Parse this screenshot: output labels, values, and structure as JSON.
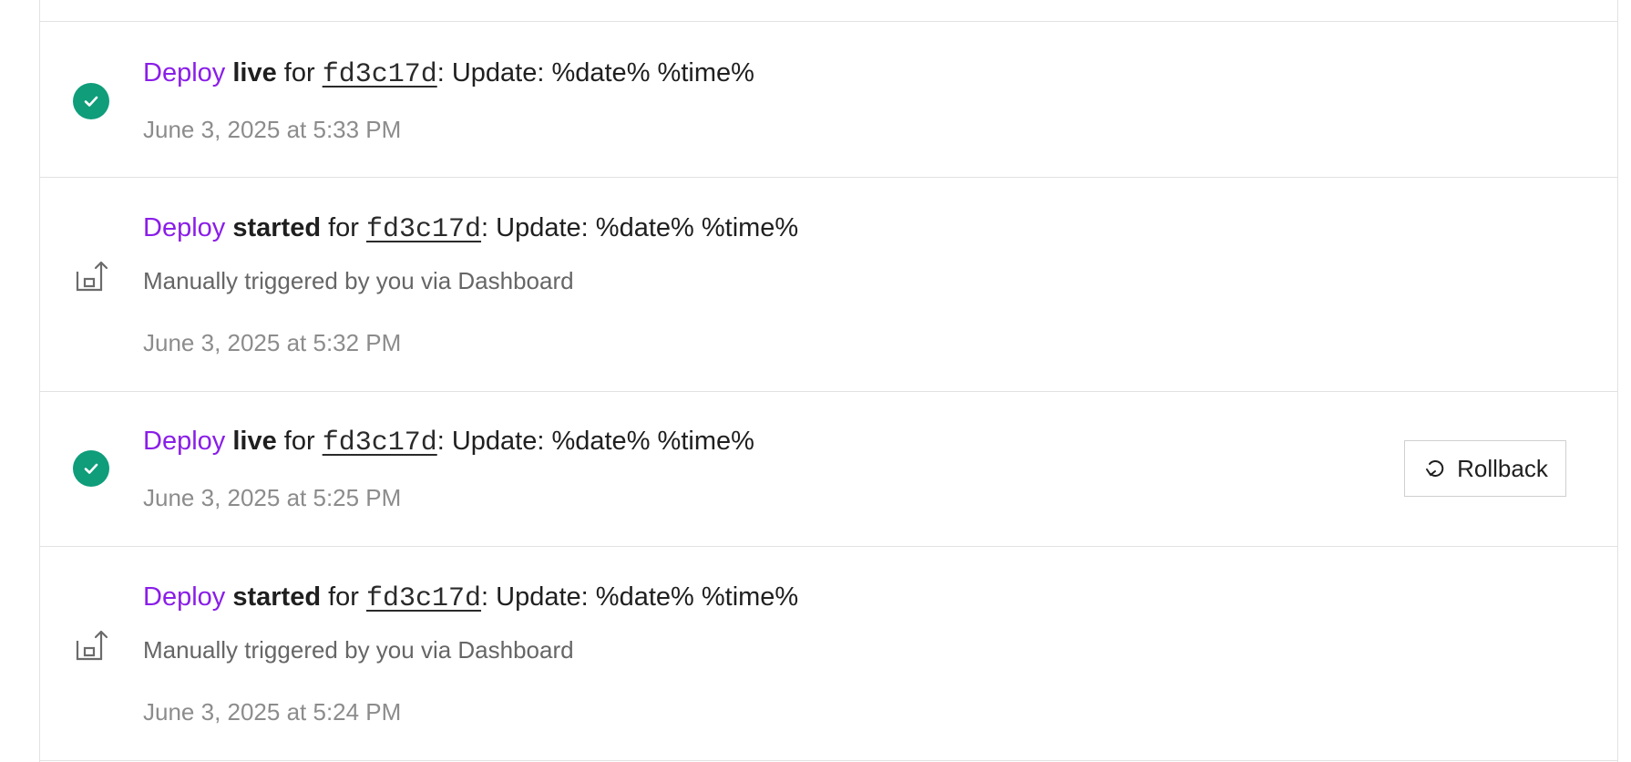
{
  "events": [
    {
      "deploy_label": "Deploy",
      "status": "live",
      "for_word": "for",
      "commit": "fd3c17d",
      "message": ": Update: %date% %time%",
      "trigger": "",
      "timestamp": "June 3, 2025 at 5:33 PM",
      "icon": "check-circle-icon"
    },
    {
      "deploy_label": "Deploy",
      "status": "started",
      "for_word": "for",
      "commit": "fd3c17d",
      "message": ": Update: %date% %time%",
      "trigger": "Manually triggered by you via Dashboard",
      "timestamp": "June 3, 2025 at 5:32 PM",
      "icon": "deploy-upload-icon"
    },
    {
      "deploy_label": "Deploy",
      "status": "live",
      "for_word": "for",
      "commit": "fd3c17d",
      "message": ": Update: %date% %time%",
      "trigger": "",
      "timestamp": "June 3, 2025 at 5:25 PM",
      "icon": "check-circle-icon",
      "action_label": "Rollback",
      "action_icon": "rollback-icon"
    },
    {
      "deploy_label": "Deploy",
      "status": "started",
      "for_word": "for",
      "commit": "fd3c17d",
      "message": ": Update: %date% %time%",
      "trigger": "Manually triggered by you via Dashboard",
      "timestamp": "June 3, 2025 at 5:24 PM",
      "icon": "deploy-upload-icon"
    }
  ],
  "colors": {
    "accent": "#8a1ee8",
    "success": "#0f9d7a",
    "border": "#e2e2e2",
    "muted_text": "#8c8c8c"
  }
}
